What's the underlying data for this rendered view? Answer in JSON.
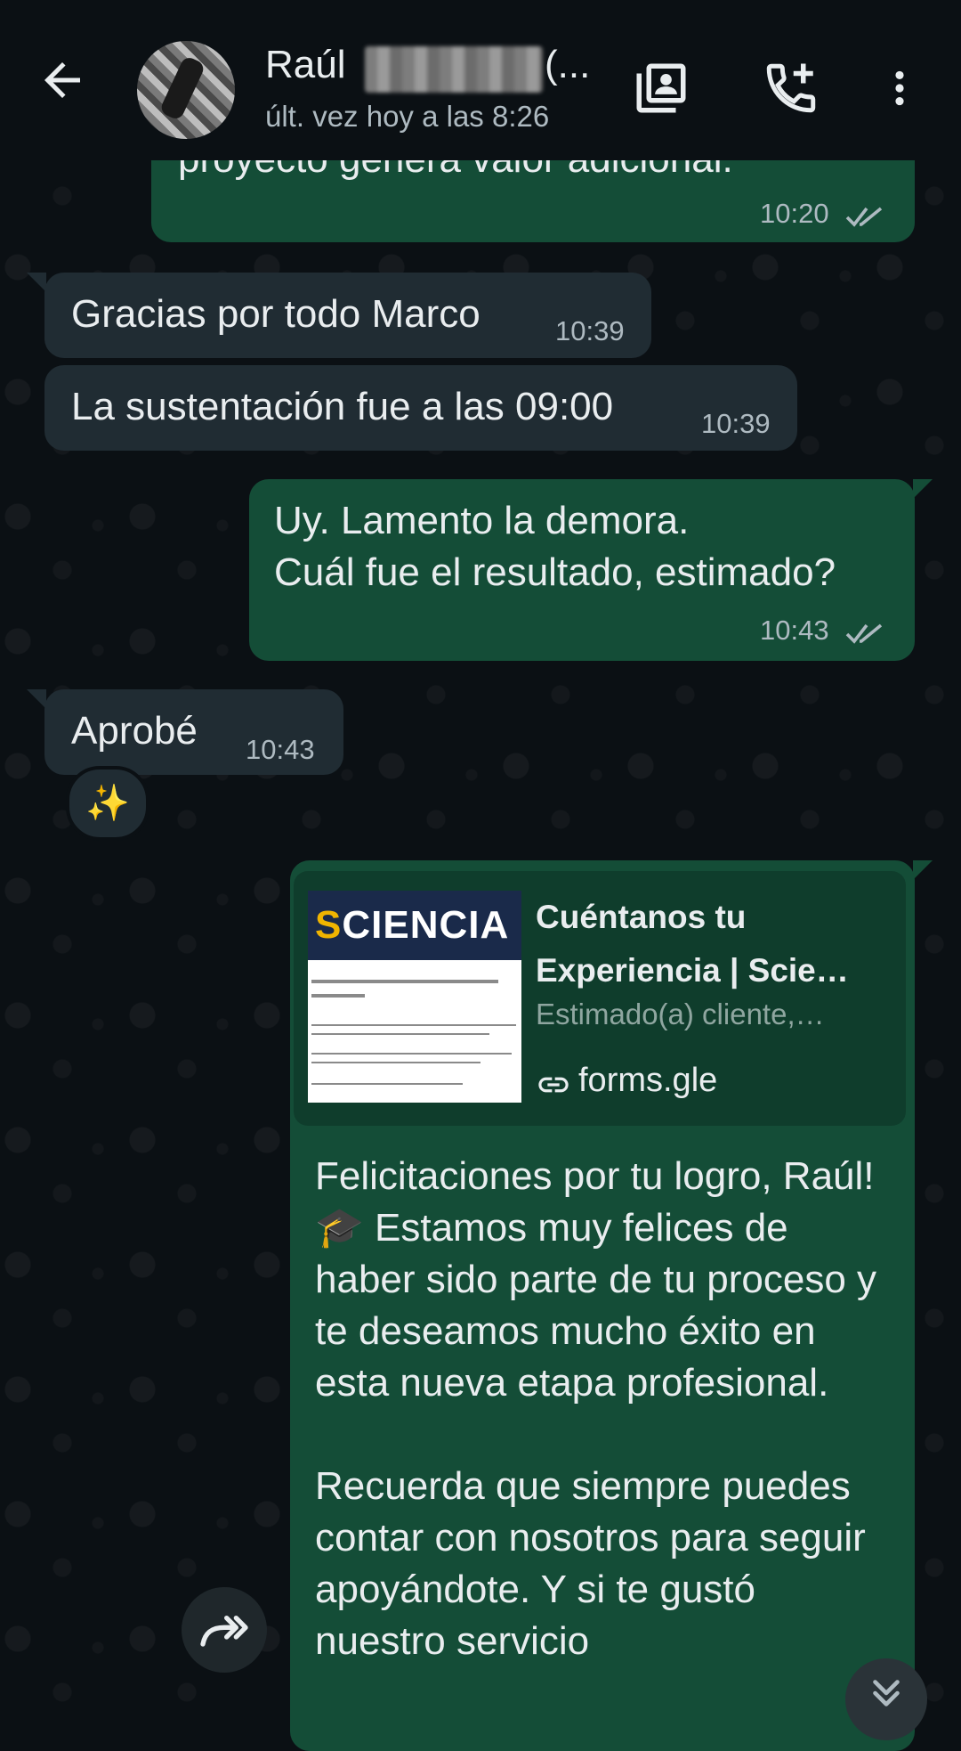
{
  "header": {
    "name": "Raúl",
    "name_tail": "(...",
    "last_seen": "últ. vez hoy a las 8:26"
  },
  "messages": [
    {
      "dir": "out",
      "text": "proyecto genera valor adicional.",
      "time": "10:20"
    },
    {
      "dir": "in",
      "text": "Gracias por todo Marco",
      "time": "10:39"
    },
    {
      "dir": "in",
      "text": "La sustentación fue a las 09:00",
      "time": "10:39"
    },
    {
      "dir": "out",
      "text": "Uy. Lamento la demora.\nCuál fue el resultado, estimado?",
      "time": "10:43"
    },
    {
      "dir": "in",
      "text": "Aprobé",
      "time": "10:43",
      "reaction": "✨"
    }
  ],
  "link_preview": {
    "thumb_logo_first": "S",
    "thumb_logo_rest": "CIENCIA",
    "title": "Cuéntanos tu Experiencia | Scie…",
    "description": "Estimado(a) cliente,…",
    "domain": "forms.gle"
  },
  "long_message": {
    "paragraph1": "Felicitaciones por tu logro, Raúl! 🎓 Estamos muy felices de haber sido parte de tu proceso y te deseamos mucho éxito en esta nueva etapa profesional.",
    "paragraph2": "Recuerda que siempre puedes contar con nosotros para seguir apoyándote. Y si te gustó nuestro servicio"
  },
  "colors": {
    "background": "#0b1014",
    "incoming_bubble": "#202c33",
    "outgoing_bubble": "#144d37",
    "secondary_text": "#aebac1"
  },
  "icons": [
    "back-arrow-icon",
    "contact-card-icon",
    "add-call-icon",
    "more-vert-icon",
    "double-check-icon",
    "link-icon",
    "forward-icon",
    "scroll-down-icon"
  ]
}
